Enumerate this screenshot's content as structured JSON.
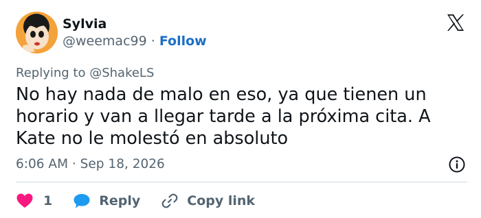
{
  "author": {
    "display_name": "Sylvia",
    "handle": "@weemac99",
    "separator": "·",
    "follow_label": "Follow"
  },
  "reply_context": "Replying to @ShakeLS",
  "body": "No hay nada de malo en eso, ya que tienen un horario y van a llegar tarde a la próxima cita. A Kate no le molestó en absoluto",
  "timestamp": "6:06 AM · Sep 18, 2026",
  "actions": {
    "like_count": "1",
    "reply_label": "Reply",
    "copy_link_label": "Copy link"
  },
  "icons": {
    "platform": "x-logo-icon",
    "info": "info-icon",
    "like": "heart-icon",
    "reply": "speech-bubble-icon",
    "copy_link": "link-icon"
  },
  "colors": {
    "text_primary": "#0f1419",
    "text_secondary": "#536471",
    "follow": "#1d6fc4",
    "like": "#f91880",
    "reply": "#1d9bf0",
    "divider": "#cfd9de"
  }
}
